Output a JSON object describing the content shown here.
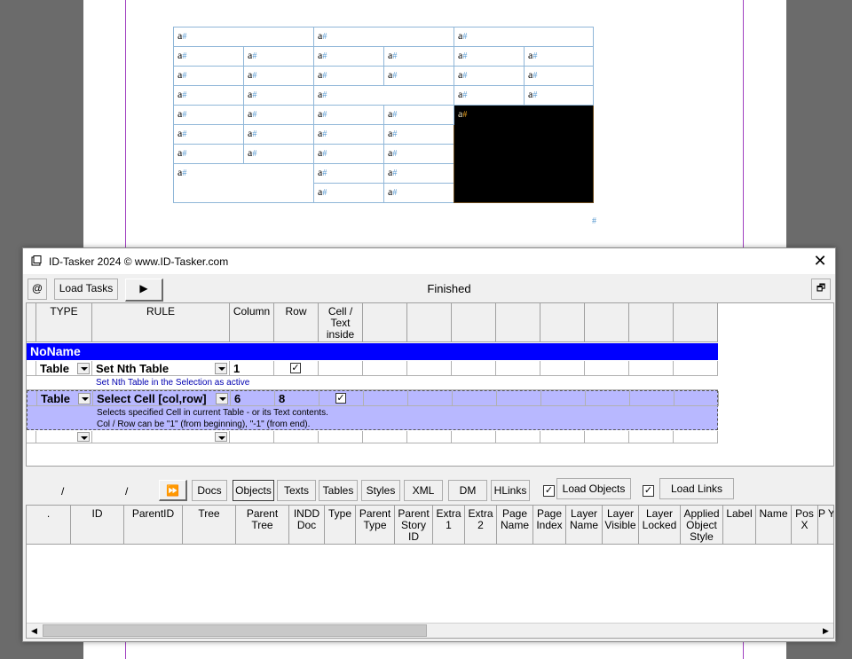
{
  "document": {
    "cell_text": "a",
    "hash": "#",
    "end_mark": "#"
  },
  "window": {
    "title": "ID-Tasker 2024  © www.ID-Tasker.com",
    "close_glyph": "✕",
    "restore_glyph": "🗗"
  },
  "toolbar": {
    "at_label": "@",
    "load_tasks_label": "Load Tasks",
    "run_glyph": "▶",
    "status": "Finished"
  },
  "rules_grid": {
    "headers": [
      "TYPE",
      "RULE",
      "Column",
      "Row",
      "Cell / Text inside",
      "",
      "",
      "",
      "",
      "",
      "",
      "",
      ""
    ],
    "group_name": "NoName",
    "rows": [
      {
        "type": "Table",
        "rule": "Set Nth Table",
        "column": "1",
        "row": "",
        "row_checked": true,
        "cell_text_checked": false,
        "desc": [
          "Set Nth Table in the Selection as active"
        ]
      },
      {
        "type": "Table",
        "rule": "Select Cell [col,row]",
        "column": "6",
        "row": "8",
        "row_checked": false,
        "cell_text_checked": true,
        "desc": [
          "Selects specified Cell in current Table - or its Text contents.",
          "Col / Row can be \"1\" (from beginning), \"-1\" (from end)."
        ]
      }
    ],
    "highlight_color": "#b8b8ff",
    "group_color": "#0000ff"
  },
  "objects_bar": {
    "slash1": "/",
    "slash2": "/",
    "ff_glyph": "⏩",
    "tabs": [
      "Docs",
      "Objects",
      "Texts",
      "Tables",
      "Styles",
      "XML",
      "DM",
      "HLinks"
    ],
    "active_tab": "Objects",
    "load_objects_checked": true,
    "load_objects_label": "Load Objects",
    "load_links_checked": true,
    "load_links_label": "Load Links"
  },
  "objects_grid": {
    "headers": [
      ".",
      "ID",
      "ParentID",
      "Tree",
      "Parent Tree",
      "INDD Doc",
      "Type",
      "Parent Type",
      "Parent Story ID",
      "Extra 1",
      "Extra 2",
      "Page Name",
      "Page Index",
      "Layer Name",
      "Layer Visible",
      "Layer Locked",
      "Applied Object Style",
      "Label",
      "Name",
      "Pos X",
      "P Y"
    ]
  },
  "scrollbar": {
    "left_glyph": "◀",
    "right_glyph": "▶"
  }
}
